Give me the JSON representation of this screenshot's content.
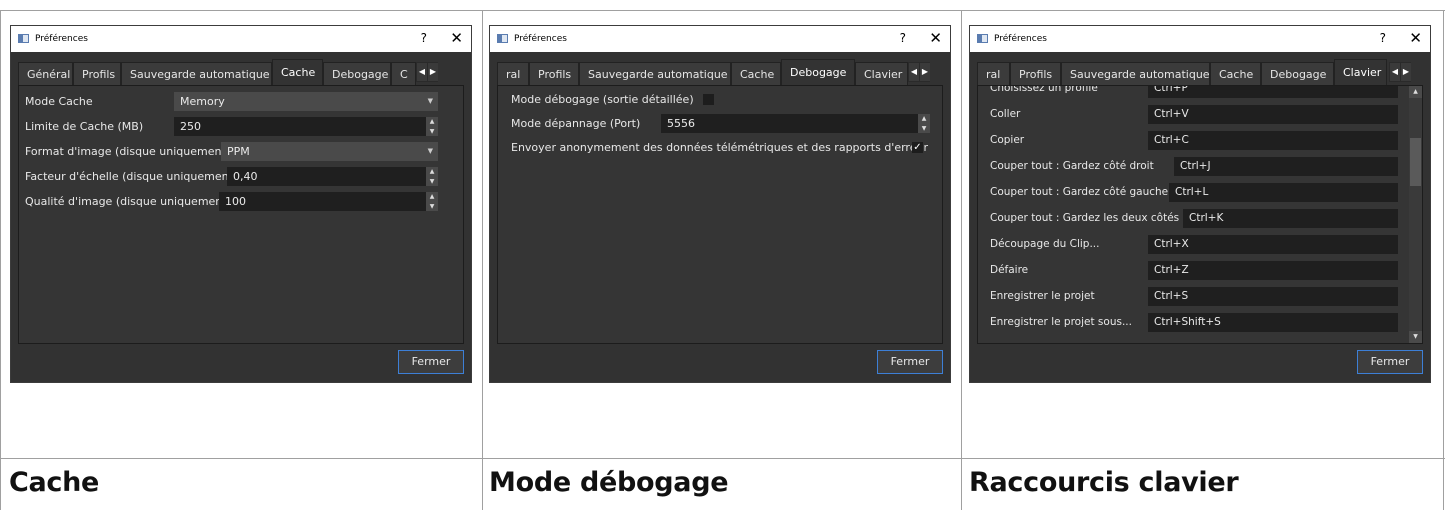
{
  "panels": [
    {
      "caption": "Cache",
      "window": {
        "title": "Préférences",
        "help": "?",
        "close": "✕",
        "tabs": [
          "Général",
          "Profils",
          "Sauvegarde automatique",
          "Cache",
          "Debogage",
          "C"
        ],
        "active_tab": "Cache",
        "fields": {
          "mode_cache_label": "Mode Cache",
          "mode_cache_value": "Memory",
          "limite_label": "Limite de Cache (MB)",
          "limite_value": "250",
          "format_label": "Format d'image (disque uniquement)",
          "format_value": "PPM",
          "facteur_label": "Facteur d'échelle (disque uniquement)",
          "facteur_value": "0,40",
          "qualite_label": "Qualité d'image (disque uniquement)",
          "qualite_value": "100"
        },
        "close_button": "Fermer"
      }
    },
    {
      "caption": "Mode débogage",
      "window": {
        "title": "Préférences",
        "help": "?",
        "close": "✕",
        "tabs": [
          "ral",
          "Profils",
          "Sauvegarde automatique",
          "Cache",
          "Debogage",
          "Clavier"
        ],
        "active_tab": "Debogage",
        "fields": {
          "debug_label": "Mode débogage (sortie détaillée)",
          "debug_checked": false,
          "port_label": "Mode dépannage (Port)",
          "port_value": "5556",
          "telemetry_label": "Envoyer anonymement des données télémétriques et des rapports d'erreur",
          "telemetry_check": "✓"
        },
        "close_button": "Fermer"
      }
    },
    {
      "caption": "Raccourcis clavier",
      "window": {
        "title": "Préférences",
        "help": "?",
        "close": "✕",
        "tabs": [
          "ral",
          "Profils",
          "Sauvegarde automatique",
          "Cache",
          "Debogage",
          "Clavier"
        ],
        "active_tab": "Clavier",
        "shortcuts": [
          {
            "label": "Choisissez un profile",
            "value": "Ctrl+P"
          },
          {
            "label": "Coller",
            "value": "Ctrl+V"
          },
          {
            "label": "Copier",
            "value": "Ctrl+C"
          },
          {
            "label": "Couper tout : Gardez côté droit",
            "value": "Ctrl+J"
          },
          {
            "label": "Couper tout : Gardez côté gauche",
            "value": "Ctrl+L"
          },
          {
            "label": "Couper tout : Gardez les deux côtés",
            "value": "Ctrl+K"
          },
          {
            "label": "Découpage du Clip...",
            "value": "Ctrl+X"
          },
          {
            "label": "Défaire",
            "value": "Ctrl+Z"
          },
          {
            "label": "Enregistrer le projet",
            "value": "Ctrl+S"
          },
          {
            "label": "Enregistrer le projet sous...",
            "value": "Ctrl+Shift+S"
          }
        ],
        "close_button": "Fermer"
      }
    }
  ]
}
